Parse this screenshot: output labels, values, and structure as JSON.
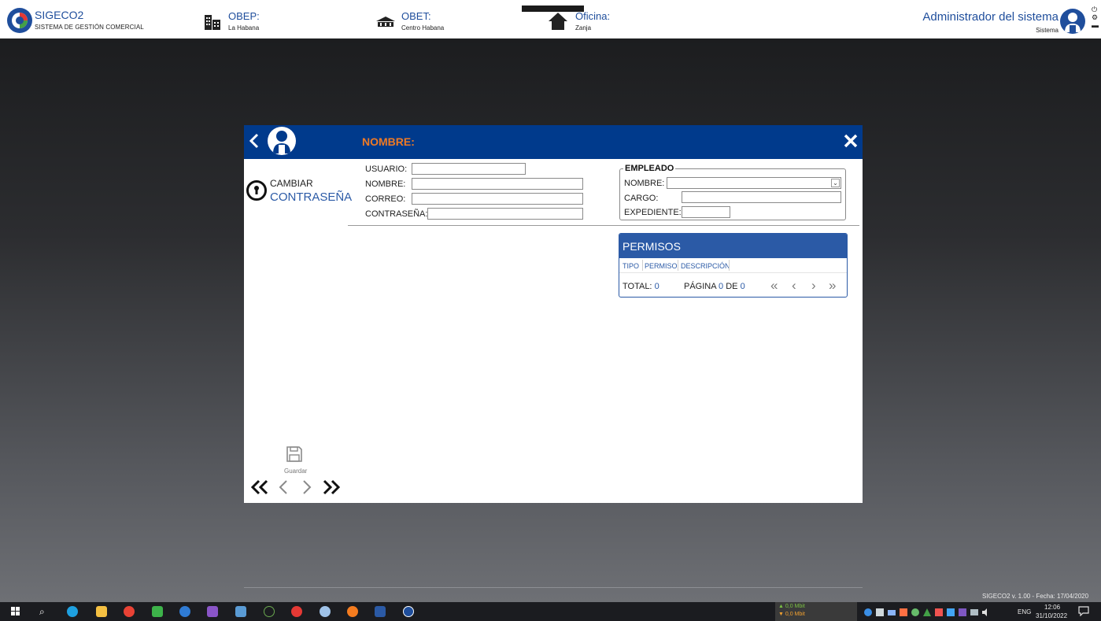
{
  "header": {
    "app_name": "SIGECO2",
    "app_subtitle": "SISTEMA DE GESTIÓN COMERCIAL",
    "obep_label": "OBEP:",
    "obep_value": "La Habana",
    "obet_label": "OBET:",
    "obet_value": "Centro Habana",
    "oficina_label": "Oficina:",
    "oficina_value": "Zanja",
    "user_name": "Administrador del sistema",
    "user_role": "Sistema"
  },
  "dialog": {
    "title": "NOMBRE:",
    "change_password_line1": "CAMBIAR",
    "change_password_line2": "CONTRASEÑA",
    "form": {
      "usuario_label": "USUARIO:",
      "usuario_value": "",
      "nombre_label": "NOMBRE:",
      "nombre_value": "",
      "correo_label": "CORREO:",
      "correo_value": "",
      "contrasena_label": "CONTRASEÑA:",
      "contrasena_value": ""
    },
    "empleado": {
      "title": "EMPLEADO",
      "nombre_label": "NOMBRE:",
      "nombre_value": "",
      "cargo_label": "CARGO:",
      "cargo_value": "",
      "expediente_label": "EXPEDIENTE:",
      "expediente_value": ""
    },
    "permisos": {
      "title": "PERMISOS",
      "columns": [
        "TIPO",
        "PERMISO",
        "DESCRIPCIÓN"
      ],
      "total_label": "TOTAL:",
      "total_value": "0",
      "page_label": "PÁGINA",
      "page_current": "0",
      "page_of": "DE",
      "page_total": "0"
    },
    "save_label": "Guardar"
  },
  "footer": {
    "version": "SIGECO2 v. 1.00 - Fecha: 17/04/2020"
  },
  "taskbar": {
    "net_up": "▲ 0,0 Mbit",
    "net_down": "▼ 0,0 Mbit",
    "language": "ENG",
    "time": "12:06",
    "date": "31/10/2022"
  },
  "colors": {
    "primary": "#003a8c",
    "accent": "#f07a24",
    "link": "#2b5aa6"
  }
}
